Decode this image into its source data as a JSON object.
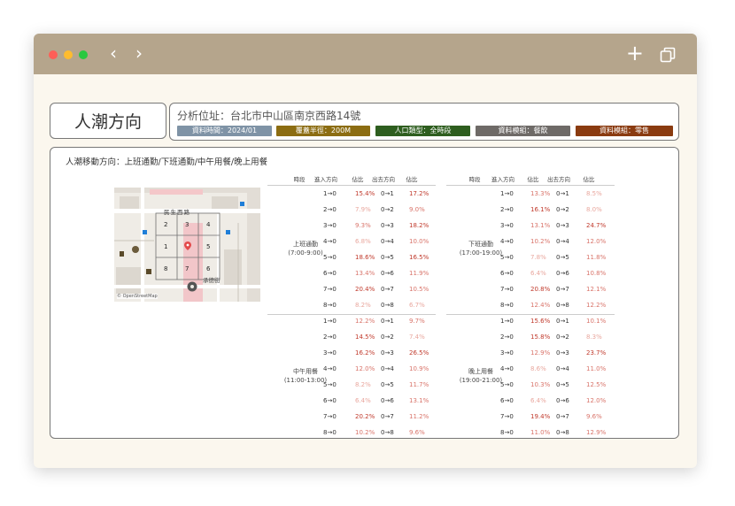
{
  "window": {
    "traffic_lights": [
      "#ff5f57",
      "#febc2e",
      "#28c840"
    ],
    "back_glyph": "‹",
    "forward_glyph": "›",
    "new_tab_glyph": "+"
  },
  "header": {
    "title": "人潮方向",
    "address": "分析位址：台北市中山區南京西路14號",
    "tags": [
      {
        "text": "資料時間：2024/01",
        "color": "#7f93a6"
      },
      {
        "text": "覆蓋半徑：200M",
        "color": "#8c6d12"
      },
      {
        "text": "人口類型：全時段",
        "color": "#2e5e1f"
      },
      {
        "text": "資料模組：餐飲",
        "color": "#6e6a67"
      },
      {
        "text": "資料模組：零售",
        "color": "#8a3b10"
      }
    ]
  },
  "panel": {
    "title": "人潮移動方向：上班通勤/下班通勤/中午用餐/晚上用餐",
    "columns": [
      "時段",
      "進入方向",
      "佔比",
      "出去方向",
      "佔比"
    ],
    "map": {
      "cells": [
        "2",
        "3",
        "4",
        "1",
        "",
        "5",
        "8",
        "7",
        "6"
      ],
      "street_top": "民生西路",
      "street_bottom": "承德街",
      "attribution": "© OpenStreetMap"
    },
    "highlight_color": "#c0392b",
    "mid_color": "#d9746a",
    "light_color": "#e9a79e",
    "blocks": [
      {
        "label": "上班通勤",
        "time": "(7:00-9:00)",
        "rows": [
          {
            "in": "1→0",
            "in_pct": "15.4%",
            "out": "0→1",
            "out_pct": "17.2%"
          },
          {
            "in": "2→0",
            "in_pct": "7.9%",
            "out": "0→2",
            "out_pct": "9.0%"
          },
          {
            "in": "3→0",
            "in_pct": "9.3%",
            "out": "0→3",
            "out_pct": "18.2%"
          },
          {
            "in": "4→0",
            "in_pct": "6.8%",
            "out": "0→4",
            "out_pct": "10.0%"
          },
          {
            "in": "5→0",
            "in_pct": "18.6%",
            "out": "0→5",
            "out_pct": "16.5%"
          },
          {
            "in": "6→0",
            "in_pct": "13.4%",
            "out": "0→6",
            "out_pct": "11.9%"
          },
          {
            "in": "7→0",
            "in_pct": "20.4%",
            "out": "0→7",
            "out_pct": "10.5%"
          },
          {
            "in": "8→0",
            "in_pct": "8.2%",
            "out": "0→8",
            "out_pct": "6.7%"
          }
        ]
      },
      {
        "label": "下班通勤",
        "time": "(17:00-19:00)",
        "rows": [
          {
            "in": "1→0",
            "in_pct": "13.3%",
            "out": "0→1",
            "out_pct": "8.5%"
          },
          {
            "in": "2→0",
            "in_pct": "16.1%",
            "out": "0→2",
            "out_pct": "8.0%"
          },
          {
            "in": "3→0",
            "in_pct": "13.1%",
            "out": "0→3",
            "out_pct": "24.7%"
          },
          {
            "in": "4→0",
            "in_pct": "10.2%",
            "out": "0→4",
            "out_pct": "12.0%"
          },
          {
            "in": "5→0",
            "in_pct": "7.8%",
            "out": "0→5",
            "out_pct": "11.8%"
          },
          {
            "in": "6→0",
            "in_pct": "6.4%",
            "out": "0→6",
            "out_pct": "10.8%"
          },
          {
            "in": "7→0",
            "in_pct": "20.8%",
            "out": "0→7",
            "out_pct": "12.1%"
          },
          {
            "in": "8→0",
            "in_pct": "12.4%",
            "out": "0→8",
            "out_pct": "12.2%"
          }
        ]
      },
      {
        "label": "中午用餐",
        "time": "(11:00-13:00)",
        "rows": [
          {
            "in": "1→0",
            "in_pct": "12.2%",
            "out": "0→1",
            "out_pct": "9.7%"
          },
          {
            "in": "2→0",
            "in_pct": "14.5%",
            "out": "0→2",
            "out_pct": "7.4%"
          },
          {
            "in": "3→0",
            "in_pct": "16.2%",
            "out": "0→3",
            "out_pct": "26.5%"
          },
          {
            "in": "4→0",
            "in_pct": "12.0%",
            "out": "0→4",
            "out_pct": "10.9%"
          },
          {
            "in": "5→0",
            "in_pct": "8.2%",
            "out": "0→5",
            "out_pct": "11.7%"
          },
          {
            "in": "6→0",
            "in_pct": "6.4%",
            "out": "0→6",
            "out_pct": "13.1%"
          },
          {
            "in": "7→0",
            "in_pct": "20.2%",
            "out": "0→7",
            "out_pct": "11.2%"
          },
          {
            "in": "8→0",
            "in_pct": "10.2%",
            "out": "0→8",
            "out_pct": "9.6%"
          }
        ]
      },
      {
        "label": "晚上用餐",
        "time": "(19:00-21:00)",
        "rows": [
          {
            "in": "1→0",
            "in_pct": "15.6%",
            "out": "0→1",
            "out_pct": "10.1%"
          },
          {
            "in": "2→0",
            "in_pct": "15.8%",
            "out": "0→2",
            "out_pct": "8.3%"
          },
          {
            "in": "3→0",
            "in_pct": "12.9%",
            "out": "0→3",
            "out_pct": "23.7%"
          },
          {
            "in": "4→0",
            "in_pct": "8.6%",
            "out": "0→4",
            "out_pct": "11.0%"
          },
          {
            "in": "5→0",
            "in_pct": "10.3%",
            "out": "0→5",
            "out_pct": "12.5%"
          },
          {
            "in": "6→0",
            "in_pct": "6.4%",
            "out": "0→6",
            "out_pct": "12.0%"
          },
          {
            "in": "7→0",
            "in_pct": "19.4%",
            "out": "0→7",
            "out_pct": "9.6%"
          },
          {
            "in": "8→0",
            "in_pct": "11.0%",
            "out": "0→8",
            "out_pct": "12.9%"
          }
        ]
      }
    ]
  }
}
